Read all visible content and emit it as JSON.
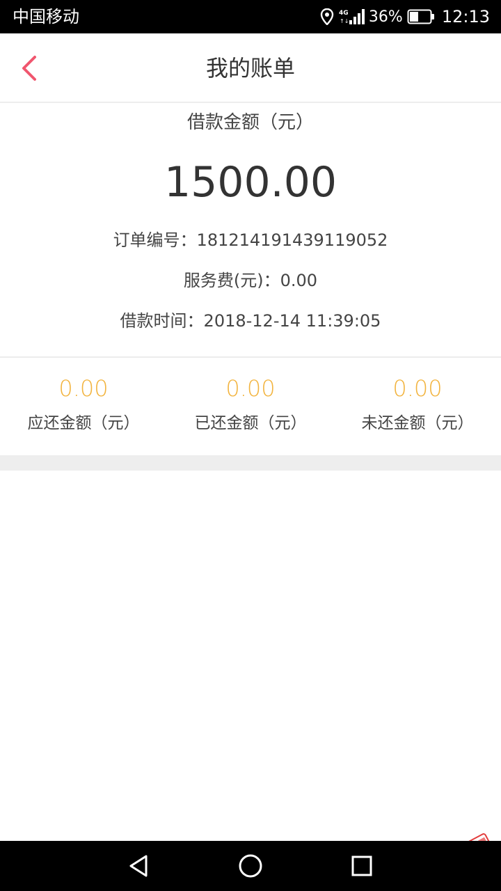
{
  "status_bar": {
    "carrier": "中国移动",
    "network": "4G",
    "battery_percent": "36%",
    "time": "12:13"
  },
  "header": {
    "title": "我的账单",
    "back_icon": "chevron-left-icon",
    "accent_color": "#f0566e"
  },
  "summary": {
    "loan_label": "借款金额（元）",
    "loan_amount": "1500.00",
    "order_line": "订单编号：181214191439119052",
    "fee_line": "服务费(元)：0.00",
    "time_line": "借款时间：2018-12-14 11:39:05"
  },
  "stats": [
    {
      "value": "0.00",
      "label": "应还金额（元）"
    },
    {
      "value": "0.00",
      "label": "已还金额（元）"
    },
    {
      "value": "0.00",
      "label": "未还金额（元）"
    }
  ],
  "stat_value_color": "#f2b33d",
  "nav_bar": {
    "back_icon": "triangle-back-icon",
    "home_icon": "circle-home-icon",
    "recents_icon": "square-recents-icon"
  }
}
